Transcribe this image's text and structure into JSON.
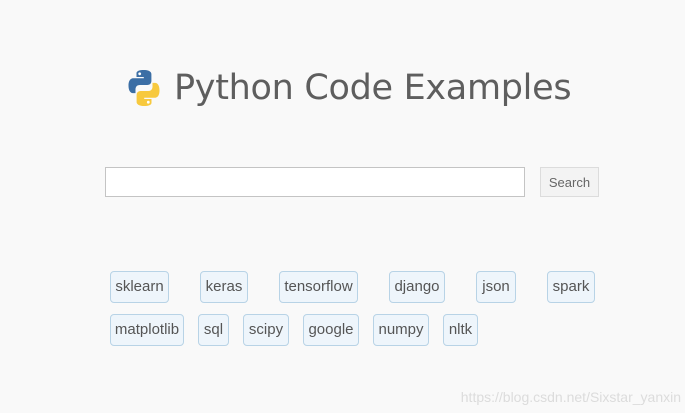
{
  "header": {
    "title": "Python Code Examples",
    "logo_icon": "python-logo-icon",
    "title_color": "#5e5e5e"
  },
  "search": {
    "value": "",
    "placeholder": "",
    "button_label": "Search"
  },
  "tags": {
    "row1": [
      "sklearn",
      "keras",
      "tensorflow",
      "django",
      "json",
      "spark"
    ],
    "row2": [
      "matplotlib",
      "sql",
      "scipy",
      "google",
      "numpy",
      "nltk"
    ],
    "border_color": "#b8d3e6",
    "background_color": "#eef5fb"
  },
  "watermark": "https://blog.csdn.net/Sixstar_yanxin"
}
